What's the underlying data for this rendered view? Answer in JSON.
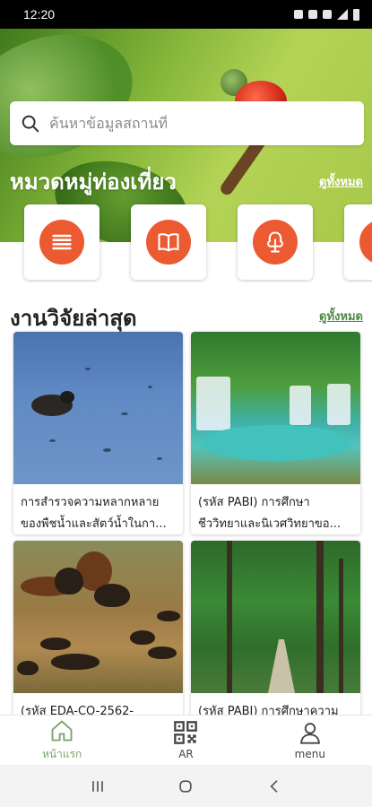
{
  "status_bar": {
    "time": "12:20"
  },
  "search": {
    "placeholder": "ค้นหาข้อมูลสถานที่"
  },
  "categories": {
    "title": "หมวดหมู่ท่องเที่ยว",
    "see_all": "ดูทั้งหมด",
    "items": [
      {
        "icon": "list-icon"
      },
      {
        "icon": "book-icon"
      },
      {
        "icon": "tree-icon"
      },
      {
        "icon": "category-icon"
      }
    ],
    "accent_color": "#ec5a32"
  },
  "research": {
    "title": "งานวิจัยล่าสุด",
    "see_all": "ดูทั้งหมด",
    "items": [
      {
        "line1": "การสำรวจความหลากหลาย",
        "line2": "ของพืชน้ำและสัตว์น้ำในกา..."
      },
      {
        "line1": "(รหัส PABI) การศึกษา",
        "line2": "ชีววิทยาและนิเวศวิทยาขอ..."
      },
      {
        "line1": "(รหัส EDA-CO-2562-",
        "line2": ""
      },
      {
        "line1": "(รหัส PABI) การศึกษาความ",
        "line2": ""
      }
    ]
  },
  "bottom_nav": {
    "home": "หน้าแรก",
    "ar": "AR",
    "menu": "menu",
    "active_color": "#7aa56a"
  }
}
